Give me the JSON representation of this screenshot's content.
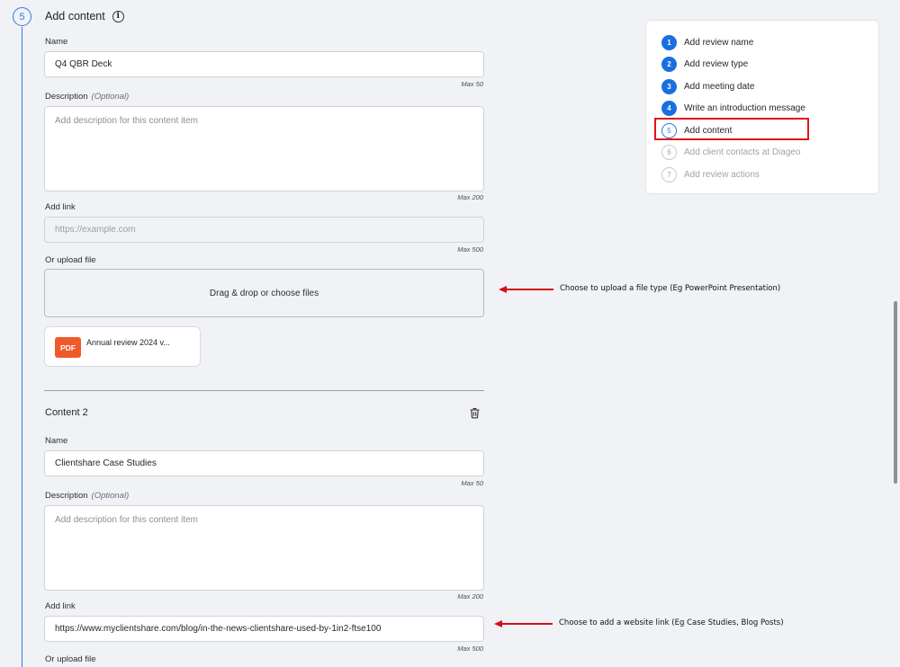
{
  "section": {
    "step_number": "5",
    "title": "Add content"
  },
  "content1": {
    "name_label": "Name",
    "name_value": "Q4 QBR Deck",
    "name_max": "Max 50",
    "description_label": "Description",
    "optional": "(Optional)",
    "description_placeholder": "Add description for this content item",
    "description_max": "Max 200",
    "link_label": "Add link",
    "link_placeholder": "https://example.com",
    "link_max": "Max 500",
    "upload_label": "Or upload file",
    "dropzone_text": "Drag & drop or choose files",
    "file": {
      "badge": "PDF",
      "name": "Annual review 2024 v..."
    }
  },
  "content2": {
    "title": "Content 2",
    "name_label": "Name",
    "name_value": "Clientshare Case Studies",
    "name_max": "Max 50",
    "description_label": "Description",
    "optional": "(Optional)",
    "description_placeholder": "Add description for this content item",
    "description_max": "Max 200",
    "link_label": "Add link",
    "link_value": "https://www.myclientshare.com/blog/in-the-news-clientshare-used-by-1in2-ftse100",
    "link_max": "Max 500",
    "upload_label": "Or upload file"
  },
  "steps": [
    {
      "number": "1",
      "label": "Add review name",
      "state": "done"
    },
    {
      "number": "2",
      "label": "Add review type",
      "state": "done"
    },
    {
      "number": "3",
      "label": "Add meeting date",
      "state": "done"
    },
    {
      "number": "4",
      "label": "Write an introduction message",
      "state": "done"
    },
    {
      "number": "5",
      "label": "Add content",
      "state": "current"
    },
    {
      "number": "6",
      "label": "Add client contacts at Diageo",
      "state": "future"
    },
    {
      "number": "7",
      "label": "Add review actions",
      "state": "future"
    }
  ],
  "annotations": {
    "upload_note": "Choose to upload a file type (Eg PowerPoint Presentation)",
    "link_note": "Choose to add a website link (Eg Case Studies, Blog Posts)"
  },
  "colors": {
    "accent": "#2e7be0",
    "step_done": "#1a6fe0",
    "highlight": "#e0161c",
    "pdf": "#ef5a2a"
  },
  "icons": {
    "info": "info-icon",
    "delete": "trash-icon"
  }
}
